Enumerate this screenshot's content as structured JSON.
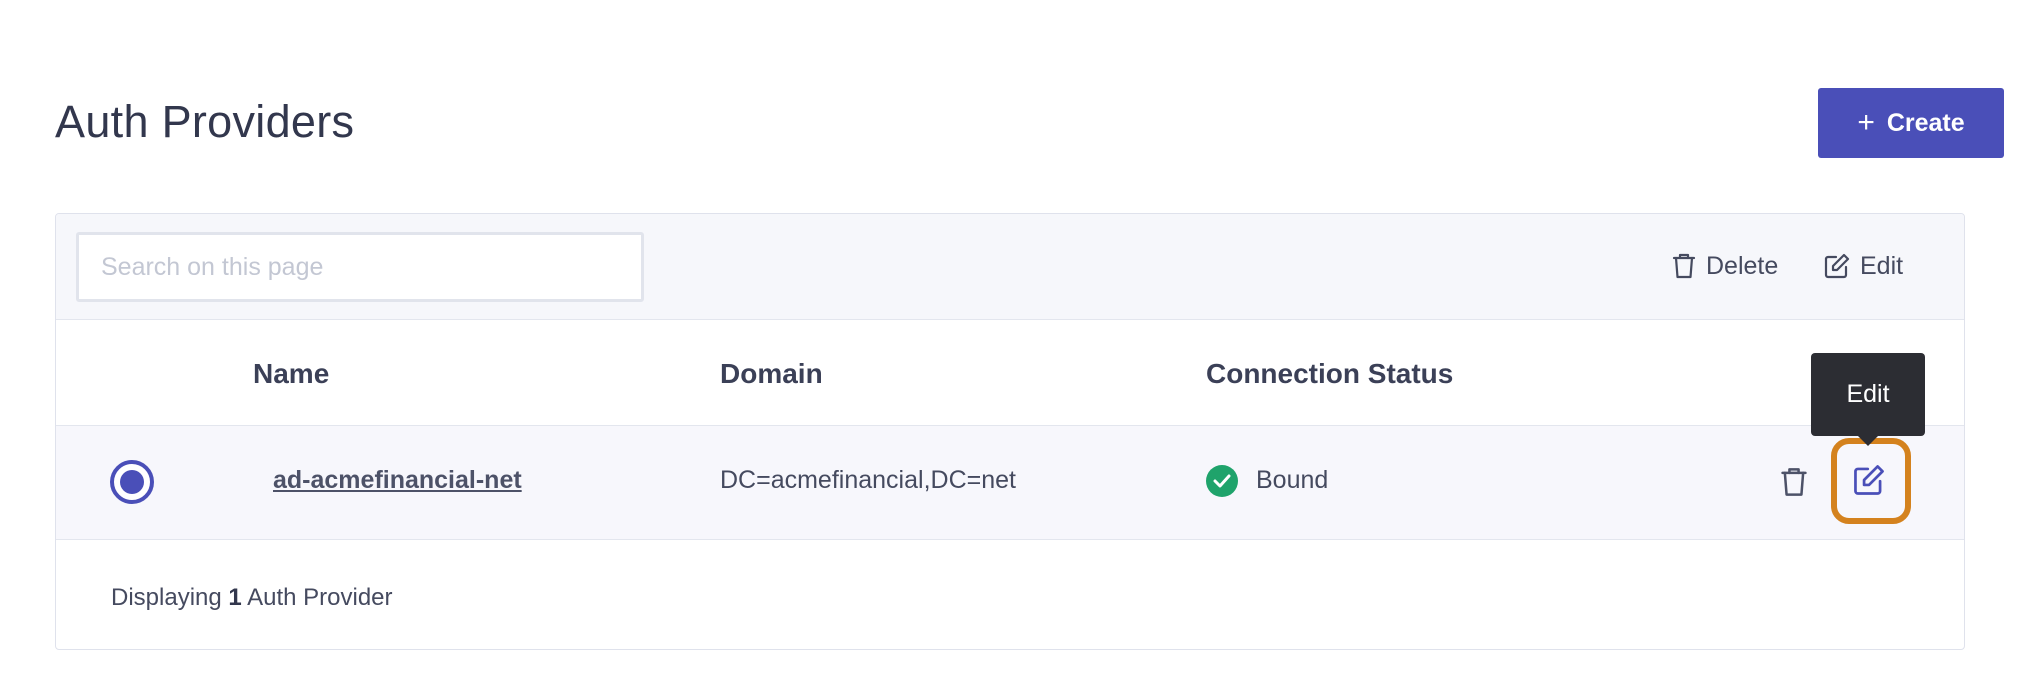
{
  "page": {
    "title": "Auth Providers",
    "create_label": "Create"
  },
  "toolbar": {
    "search_placeholder": "Search on this page",
    "delete_label": "Delete",
    "edit_label": "Edit"
  },
  "table": {
    "columns": [
      "Name",
      "Domain",
      "Connection Status"
    ],
    "rows": [
      {
        "selected": true,
        "name": "ad-acmefinancial-net",
        "domain": "DC=acmefinancial,DC=net",
        "status": "Bound",
        "status_icon": "check-circle-icon"
      }
    ]
  },
  "footer": {
    "prefix": "Displaying",
    "count": "1",
    "suffix": "Auth Provider"
  },
  "tooltip": {
    "text": "Edit"
  },
  "colors": {
    "accent": "#4a4fb8",
    "success": "#1fa36b",
    "highlight": "#d4821e",
    "tooltip_bg": "#2c2d33"
  }
}
